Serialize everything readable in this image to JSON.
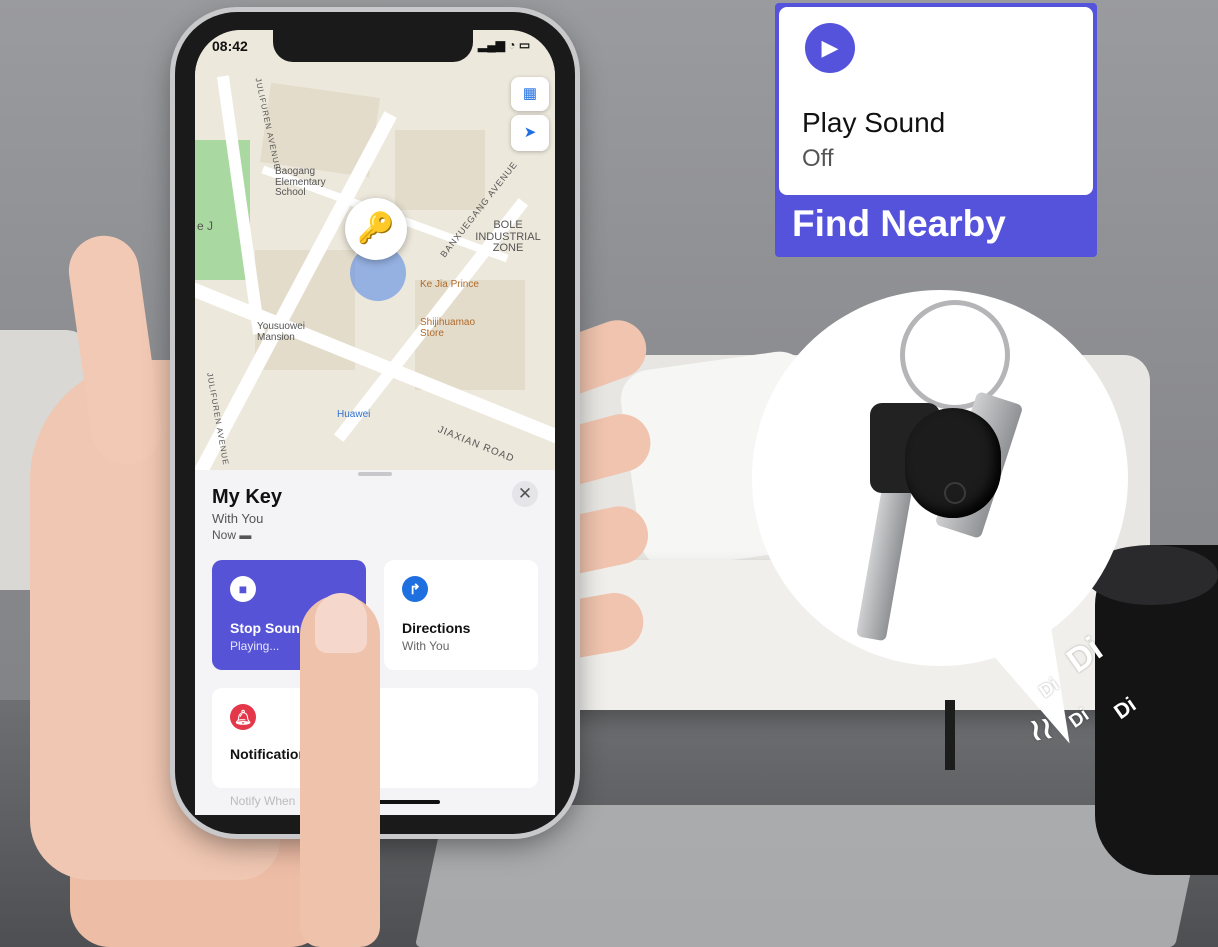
{
  "phone": {
    "status_time": "08:42",
    "status_signal": "4G",
    "map_labels": {
      "school": "Baogang Elementary School",
      "bole": "BOLE INDUSTRIAL ZONE",
      "avenue1": "JULIFUREN AVENUE",
      "avenue2": "BANXUEGANG AVENUE",
      "kejia": "Ke Jia Prince",
      "shijihuamao": "Shijihuamao Store",
      "yousuowei": "Yousuowei Mansion",
      "huawei": "Huawei",
      "jiaxian": "JIAXIAN ROAD",
      "avenue_left": "JULIFUREN AVENUE",
      "edge_j": "e J"
    },
    "item": {
      "title": "My Key",
      "subtitle": "With You",
      "timestamp": "Now"
    },
    "actions": {
      "stop_title": "Stop Sound",
      "stop_sub": "Playing...",
      "dir_title": "Directions",
      "dir_sub": "With You",
      "notif_title": "Notifications",
      "notif_sub": "Notify When"
    },
    "icons": {
      "map_mode": "map-icon",
      "locate": "location-arrow-icon",
      "close": "close-icon",
      "stop": "stop-icon",
      "directions": "directions-icon",
      "bell": "bell-icon"
    }
  },
  "find_nearby": {
    "action": "Play Sound",
    "state": "Off",
    "label": "Find Nearby",
    "accent": "#5553dc"
  },
  "bubble": {
    "sound_words": [
      "Di",
      "Di",
      "Di",
      "Di"
    ]
  }
}
